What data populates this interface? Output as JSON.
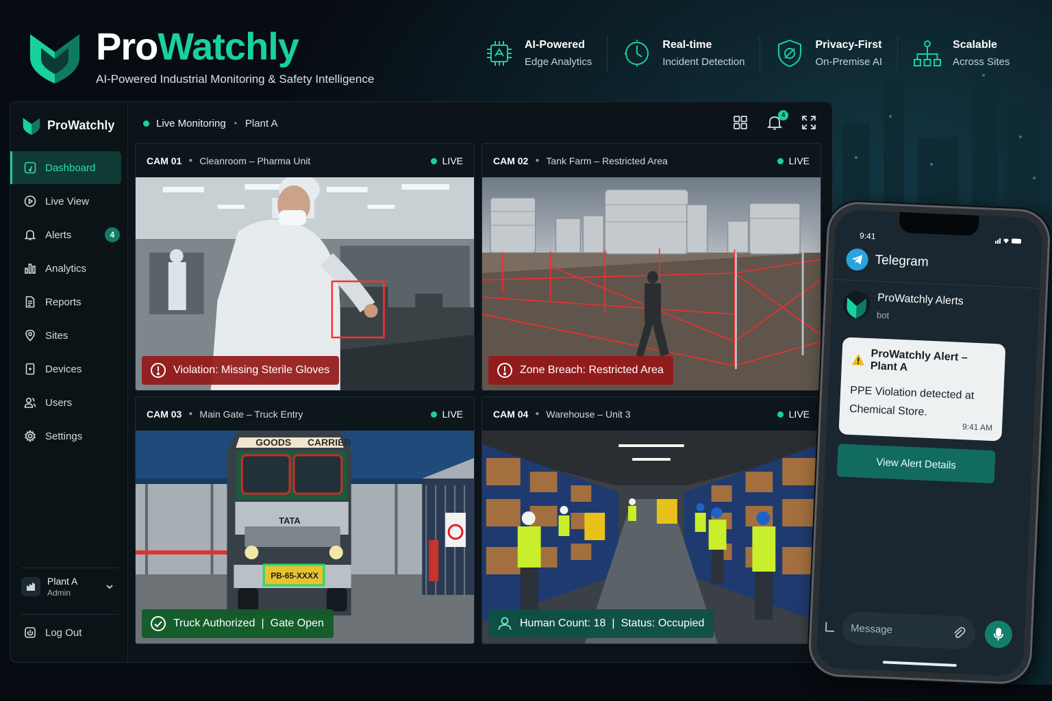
{
  "brand": {
    "name_part1": "Pro",
    "name_part2": "Watchly",
    "tagline": "AI-Powered Industrial Monitoring & Safety Intelligence"
  },
  "features": [
    {
      "title": "AI-Powered",
      "subtitle": "Edge Analytics",
      "icon": "chip-icon"
    },
    {
      "title": "Real-time",
      "subtitle": "Incident Detection",
      "icon": "clock-check-icon"
    },
    {
      "title": "Privacy-First",
      "subtitle": "On-Premise AI",
      "icon": "shield-icon"
    },
    {
      "title": "Scalable",
      "subtitle": "Across Sites",
      "icon": "network-icon"
    }
  ],
  "sidebar": {
    "brand": "ProWatchly",
    "items": [
      {
        "label": "Dashboard",
        "icon": "dashboard-icon",
        "active": true
      },
      {
        "label": "Live View",
        "icon": "play-icon"
      },
      {
        "label": "Alerts",
        "icon": "bell-icon",
        "badge": "4"
      },
      {
        "label": "Analytics",
        "icon": "bar-chart-icon"
      },
      {
        "label": "Reports",
        "icon": "document-icon"
      },
      {
        "label": "Sites",
        "icon": "location-pin-icon"
      },
      {
        "label": "Devices",
        "icon": "device-icon"
      },
      {
        "label": "Users",
        "icon": "users-icon"
      },
      {
        "label": "Settings",
        "icon": "gear-icon"
      }
    ],
    "user": {
      "name": "Plant A",
      "role": "Admin"
    },
    "logout": "Log Out"
  },
  "topbar": {
    "status": "Live Monitoring",
    "site": "Plant A",
    "notification_count": "4"
  },
  "cameras": [
    {
      "id": "CAM 01",
      "location": "Cleanroom – Pharma Unit",
      "live": "LIVE",
      "overlay": "Violation: Missing Sterile Gloves"
    },
    {
      "id": "CAM 02",
      "location": "Tank Farm – Restricted Area",
      "live": "LIVE",
      "overlay": "Zone Breach: Restricted Area"
    },
    {
      "id": "CAM 03",
      "location": "Main Gate – Truck Entry",
      "live": "LIVE",
      "overlay_a": "Truck Authorized",
      "overlay_sep": "|",
      "overlay_b": "Gate Open",
      "truck_sign_left": "GOODS",
      "truck_sign_right": "CARRIER",
      "truck_brand": "TATA",
      "plate": "PB-65-XXXX"
    },
    {
      "id": "CAM 04",
      "location": "Warehouse – Unit 3",
      "live": "LIVE",
      "overlay_a": "Human Count: 18",
      "overlay_sep": "|",
      "overlay_b": "Status: Occupied"
    }
  ],
  "phone": {
    "time": "9:41",
    "app": "Telegram",
    "bot_name": "ProWatchly Alerts",
    "bot_sub": "bot",
    "message_title": "ProWatchly Alert – Plant A",
    "message_body": "PPE Violation detected at Chemical Store.",
    "message_time": "9:41 AM",
    "button": "View Alert Details",
    "input_placeholder": "Message"
  },
  "colors": {
    "accent": "#19d19e",
    "alert_red": "#961818",
    "ok_green": "#125c28",
    "teal": "#0e5046"
  }
}
